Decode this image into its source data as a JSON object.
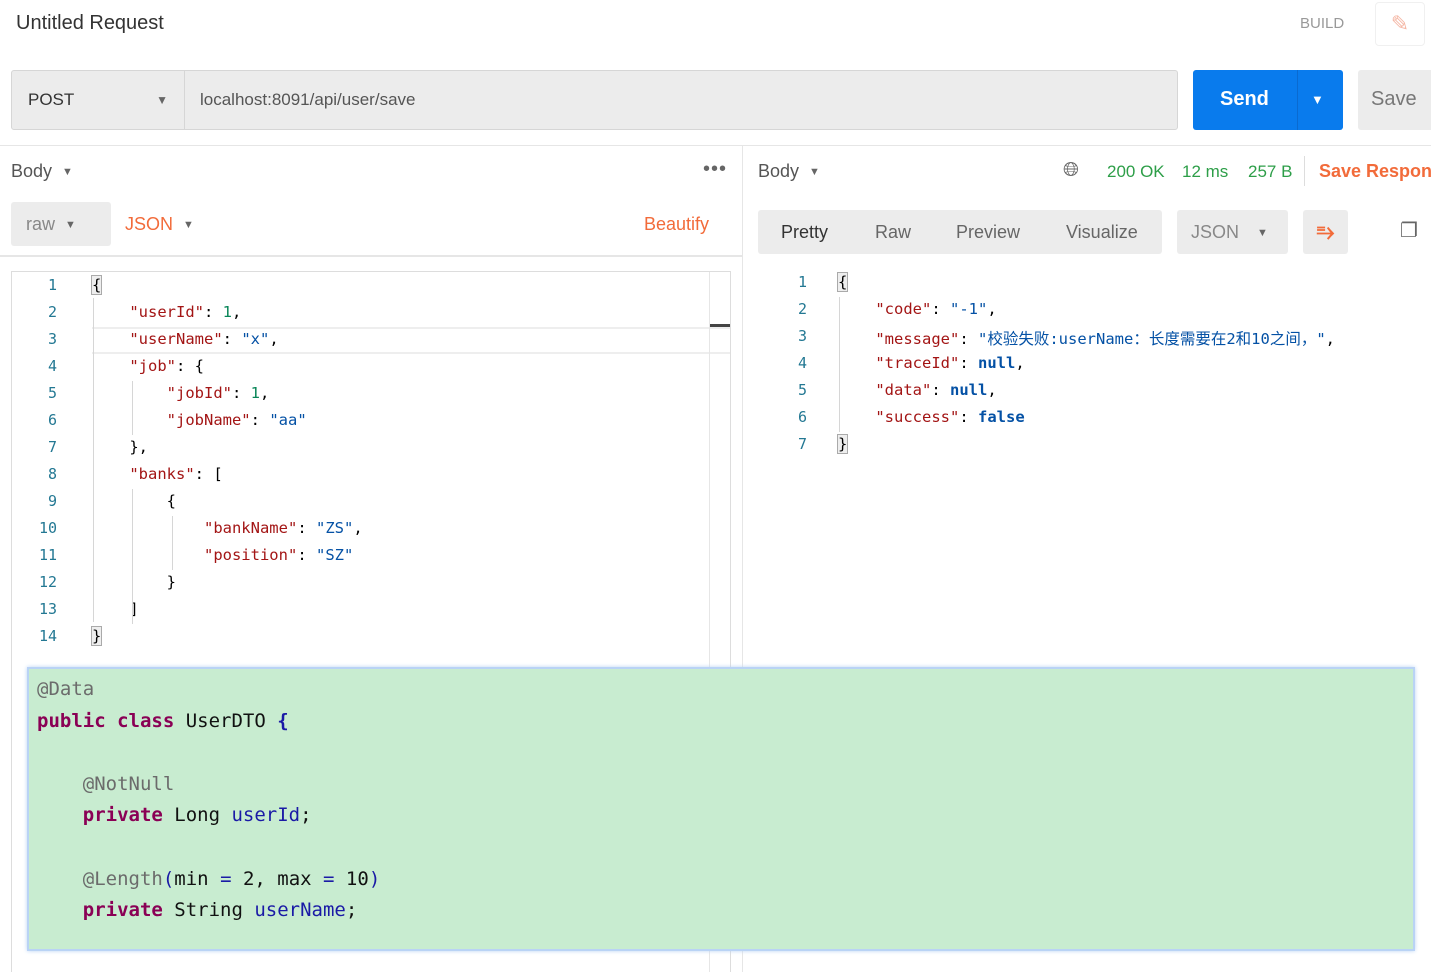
{
  "header": {
    "title": "Untitled Request",
    "build_label": "BUILD",
    "edit_icon": "pencil-icon"
  },
  "request": {
    "method": "POST",
    "url": "localhost:8091/api/user/save",
    "send_label": "Send",
    "save_label": "Save"
  },
  "request_body": {
    "section_label": "Body",
    "mode": "raw",
    "format": "JSON",
    "beautify_label": "Beautify",
    "lines": [
      [
        {
          "t": "{",
          "c": "p br"
        }
      ],
      [
        {
          "t": "    "
        },
        {
          "t": "\"userId\"",
          "c": "k"
        },
        {
          "t": ": ",
          "c": "p"
        },
        {
          "t": "1",
          "c": "n"
        },
        {
          "t": ",",
          "c": "p"
        }
      ],
      [
        {
          "t": "    "
        },
        {
          "t": "\"userName\"",
          "c": "k"
        },
        {
          "t": ": ",
          "c": "p"
        },
        {
          "t": "\"x\"",
          "c": "s"
        },
        {
          "t": ",",
          "c": "p"
        }
      ],
      [
        {
          "t": "    "
        },
        {
          "t": "\"job\"",
          "c": "k"
        },
        {
          "t": ": {",
          "c": "p"
        }
      ],
      [
        {
          "t": "        "
        },
        {
          "t": "\"jobId\"",
          "c": "k"
        },
        {
          "t": ": ",
          "c": "p"
        },
        {
          "t": "1",
          "c": "n"
        },
        {
          "t": ",",
          "c": "p"
        }
      ],
      [
        {
          "t": "        "
        },
        {
          "t": "\"jobName\"",
          "c": "k"
        },
        {
          "t": ": ",
          "c": "p"
        },
        {
          "t": "\"aa\"",
          "c": "s"
        }
      ],
      [
        {
          "t": "    "
        },
        {
          "t": "},",
          "c": "p"
        }
      ],
      [
        {
          "t": "    "
        },
        {
          "t": "\"banks\"",
          "c": "k"
        },
        {
          "t": ": [",
          "c": "p"
        }
      ],
      [
        {
          "t": "        "
        },
        {
          "t": "{",
          "c": "p"
        }
      ],
      [
        {
          "t": "            "
        },
        {
          "t": "\"bankName\"",
          "c": "k"
        },
        {
          "t": ": ",
          "c": "p"
        },
        {
          "t": "\"ZS\"",
          "c": "s"
        },
        {
          "t": ",",
          "c": "p"
        }
      ],
      [
        {
          "t": "            "
        },
        {
          "t": "\"position\"",
          "c": "k"
        },
        {
          "t": ": ",
          "c": "p"
        },
        {
          "t": "\"SZ\"",
          "c": "s"
        }
      ],
      [
        {
          "t": "        "
        },
        {
          "t": "}",
          "c": "p"
        }
      ],
      [
        {
          "t": "    "
        },
        {
          "t": "]",
          "c": "p"
        }
      ],
      [
        {
          "t": "}",
          "c": "p br"
        }
      ]
    ]
  },
  "response": {
    "section_label": "Body",
    "status": "200 OK",
    "time": "12 ms",
    "size": "257 B",
    "save_response_label": "Save Response",
    "view_tabs": [
      "Pretty",
      "Raw",
      "Preview",
      "Visualize"
    ],
    "format": "JSON",
    "status_color": "#2d9e48",
    "accent": "#f26b3a",
    "lines": [
      [
        {
          "t": "{",
          "c": "p br"
        }
      ],
      [
        {
          "t": "    "
        },
        {
          "t": "\"code\"",
          "c": "k"
        },
        {
          "t": ": ",
          "c": "p"
        },
        {
          "t": "\"-1\"",
          "c": "s"
        },
        {
          "t": ",",
          "c": "p"
        }
      ],
      [
        {
          "t": "    "
        },
        {
          "t": "\"message\"",
          "c": "k"
        },
        {
          "t": ": ",
          "c": "p"
        },
        {
          "t": "\"校验失败:userName：长度需要在2和10之间，\"",
          "c": "s"
        },
        {
          "t": ",",
          "c": "p"
        }
      ],
      [
        {
          "t": "    "
        },
        {
          "t": "\"traceId\"",
          "c": "k"
        },
        {
          "t": ": ",
          "c": "p"
        },
        {
          "t": "null",
          "c": "b"
        },
        {
          "t": ",",
          "c": "p"
        }
      ],
      [
        {
          "t": "    "
        },
        {
          "t": "\"data\"",
          "c": "k"
        },
        {
          "t": ": ",
          "c": "p"
        },
        {
          "t": "null",
          "c": "b"
        },
        {
          "t": ",",
          "c": "p"
        }
      ],
      [
        {
          "t": "    "
        },
        {
          "t": "\"success\"",
          "c": "k"
        },
        {
          "t": ": ",
          "c": "p"
        },
        {
          "t": "false",
          "c": "b"
        }
      ],
      [
        {
          "t": "}",
          "c": "p br"
        }
      ]
    ]
  },
  "java_overlay": {
    "lines": [
      [
        {
          "t": "@Data",
          "c": "an"
        }
      ],
      [
        {
          "t": "public",
          "c": "kw"
        },
        {
          "t": " "
        },
        {
          "t": "class",
          "c": "kw"
        },
        {
          "t": " UserDTO ",
          "c": "ty"
        },
        {
          "t": "{",
          "c": "br2"
        }
      ],
      [],
      [
        {
          "t": "    "
        },
        {
          "t": "@NotNull",
          "c": "an"
        }
      ],
      [
        {
          "t": "    "
        },
        {
          "t": "private",
          "c": "kw"
        },
        {
          "t": " Long ",
          "c": "ty"
        },
        {
          "t": "userId",
          "c": "fd"
        },
        {
          "t": ";",
          "c": "ty"
        }
      ],
      [],
      [
        {
          "t": "    "
        },
        {
          "t": "@Length",
          "c": "an"
        },
        {
          "t": "(",
          "c": "op"
        },
        {
          "t": "min ",
          "c": "ty"
        },
        {
          "t": "=",
          "c": "op"
        },
        {
          "t": " 2, max ",
          "c": "ty"
        },
        {
          "t": "=",
          "c": "op"
        },
        {
          "t": " 10",
          "c": "ty"
        },
        {
          "t": ")",
          "c": "op"
        }
      ],
      [
        {
          "t": "    "
        },
        {
          "t": "private",
          "c": "kw"
        },
        {
          "t": " String ",
          "c": "ty"
        },
        {
          "t": "userName",
          "c": "fd"
        },
        {
          "t": ";",
          "c": "ty"
        }
      ]
    ]
  }
}
